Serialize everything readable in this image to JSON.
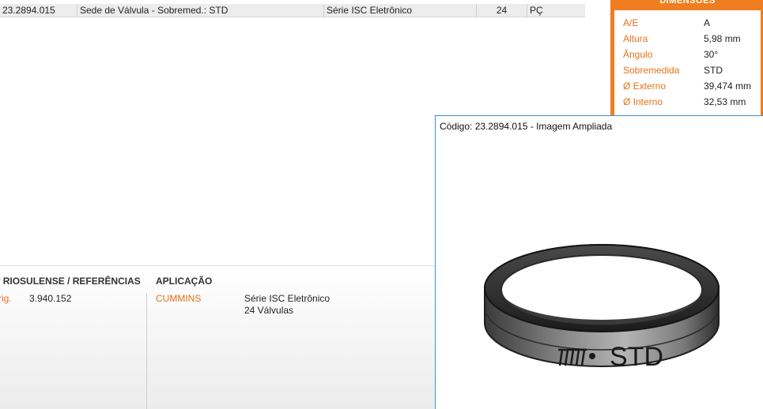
{
  "row": {
    "code": "23.2894.015",
    "description": "Sede de Válvula - Sobremed.: STD",
    "series": "Série ISC Eletrônico",
    "quantity": "24",
    "unit": "PÇ"
  },
  "dimensions": {
    "header": "DIMENSÕES",
    "items": [
      {
        "label": "A/E",
        "value": "A"
      },
      {
        "label": "Altura",
        "value": "5,98 mm"
      },
      {
        "label": "Ângulo",
        "value": "30°"
      },
      {
        "label": "Sobremedida",
        "value": "STD"
      },
      {
        "label": "Ø Externo",
        "value": "39,474 mm"
      },
      {
        "label": "Ø Interno",
        "value": "32,53 mm"
      }
    ]
  },
  "references": {
    "title": "º RIOSULENSE / REFERÊNCIAS",
    "label": "rig.",
    "value": "3.940.152"
  },
  "application": {
    "title": "APLICAÇÃO",
    "brand": "CUMMINS",
    "line1": "Série ISC Eletrônico",
    "line2": "24 Válvulas"
  },
  "popup": {
    "title": "Código: 23.2894.015 - Imagem Ampliada",
    "ring_marking": "STD"
  },
  "colors": {
    "accent": "#f07d1f",
    "popup_border": "#3c8fd8"
  }
}
